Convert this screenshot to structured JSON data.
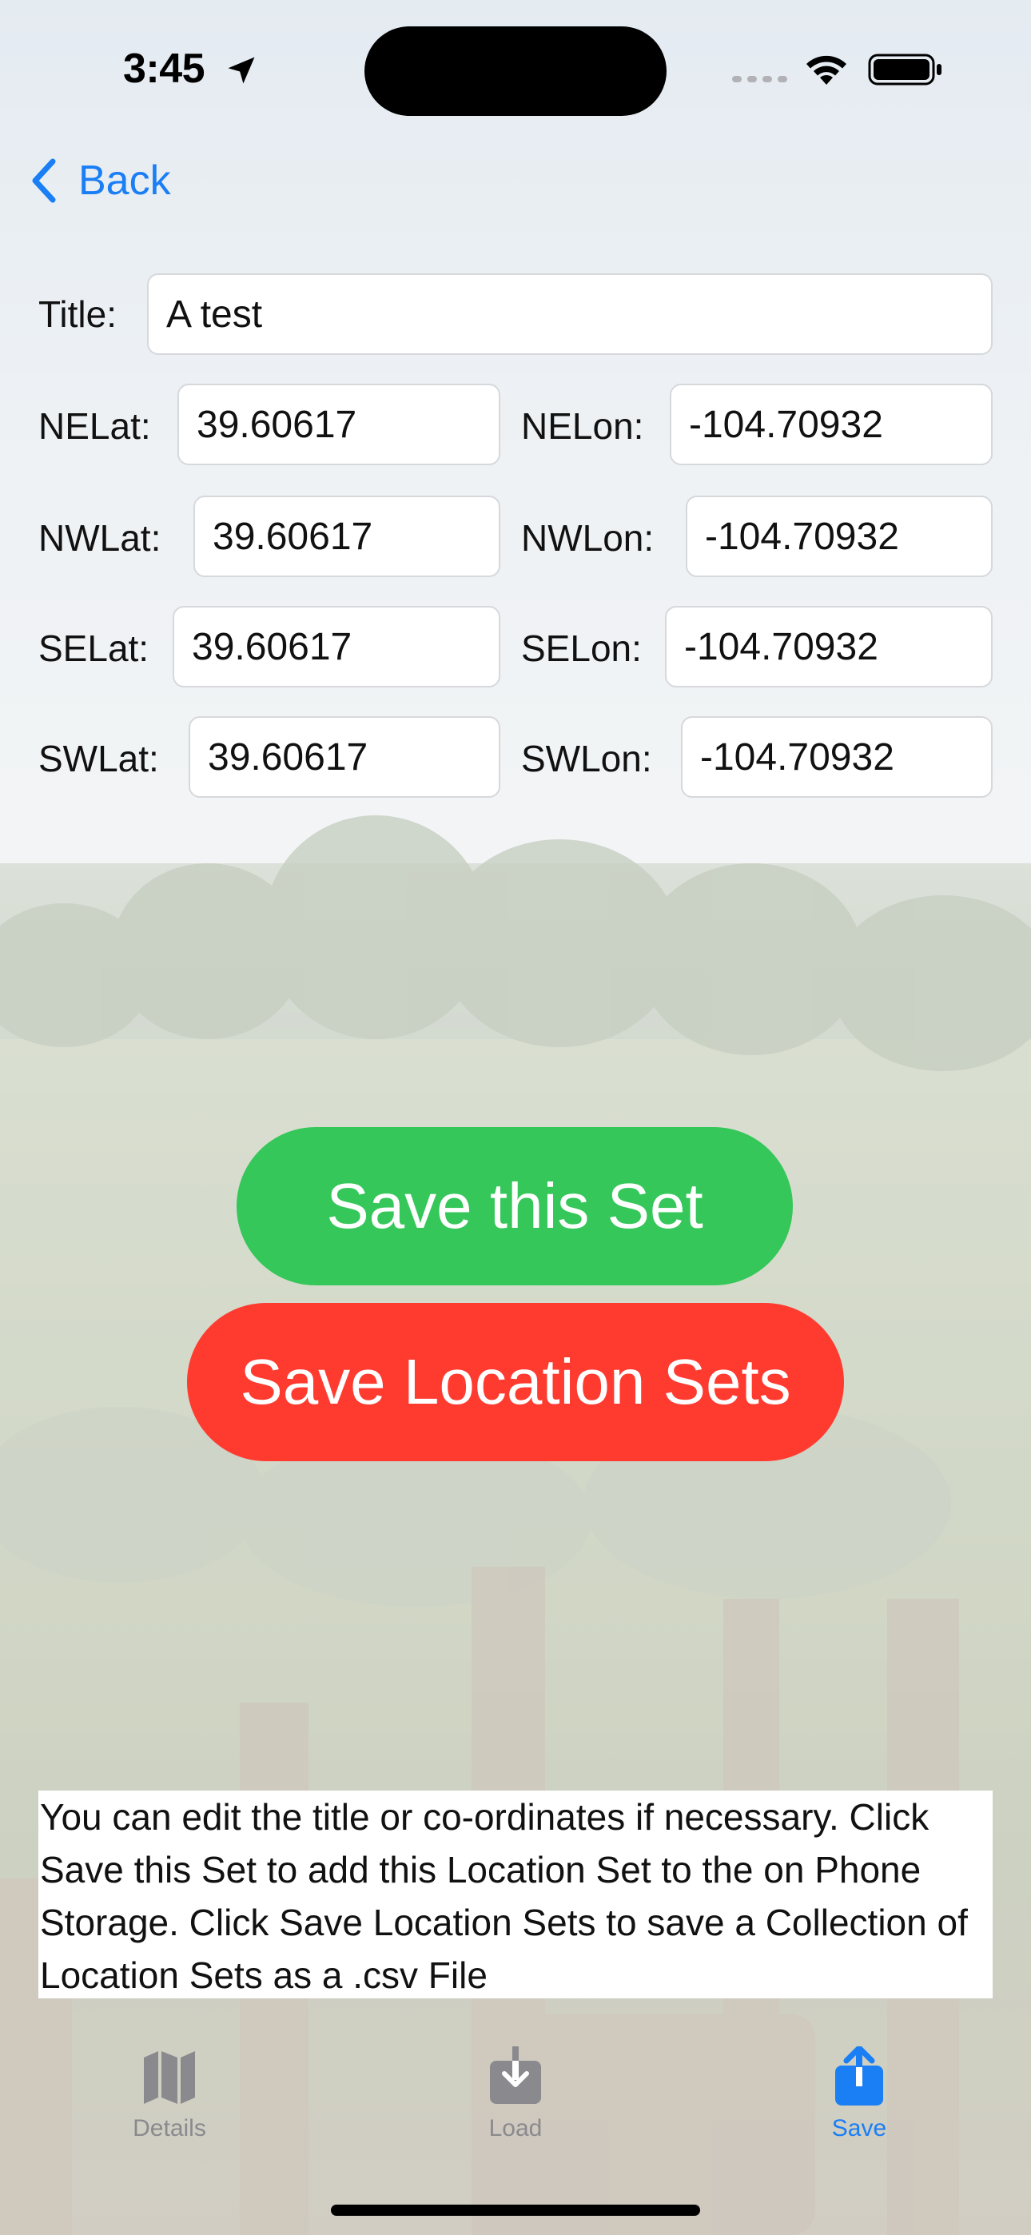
{
  "status_bar": {
    "time": "3:45",
    "icons": [
      "location-arrow-icon",
      "cellular-signal-icon",
      "wifi-icon",
      "battery-icon"
    ]
  },
  "nav": {
    "back_label": "Back",
    "accent_color": "#1a7ef5"
  },
  "form": {
    "title_label": "Title:",
    "title_value": "A test",
    "rows": [
      {
        "lat_label": "NELat:",
        "lat_value": "39.60617",
        "lon_label": "NELon:",
        "lon_value": "-104.70932"
      },
      {
        "lat_label": "NWLat:",
        "lat_value": "39.60617",
        "lon_label": "NWLon:",
        "lon_value": "-104.70932"
      },
      {
        "lat_label": "SELat:",
        "lat_value": "39.60617",
        "lon_label": "SELon:",
        "lon_value": "-104.70932"
      },
      {
        "lat_label": "SWLat:",
        "lat_value": "39.60617",
        "lon_label": "SWLon:",
        "lon_value": "-104.70932"
      }
    ]
  },
  "actions": {
    "save_set_label": "Save this Set",
    "save_set_color": "#35c759",
    "save_sets_label": "Save Location Sets",
    "save_sets_color": "#ff3b30"
  },
  "help_text": "You can edit the title or co-ordinates if necessary. Click Save this Set to add this Location Set to the on Phone Storage. Click Save Location Sets to save a Collection of Location Sets as a .csv File",
  "tab_bar": {
    "tabs": [
      {
        "label": "Details",
        "icon": "map-icon",
        "active": false
      },
      {
        "label": "Load",
        "icon": "download-tray-icon",
        "active": false
      },
      {
        "label": "Save",
        "icon": "share-upload-icon",
        "active": true
      }
    ]
  }
}
